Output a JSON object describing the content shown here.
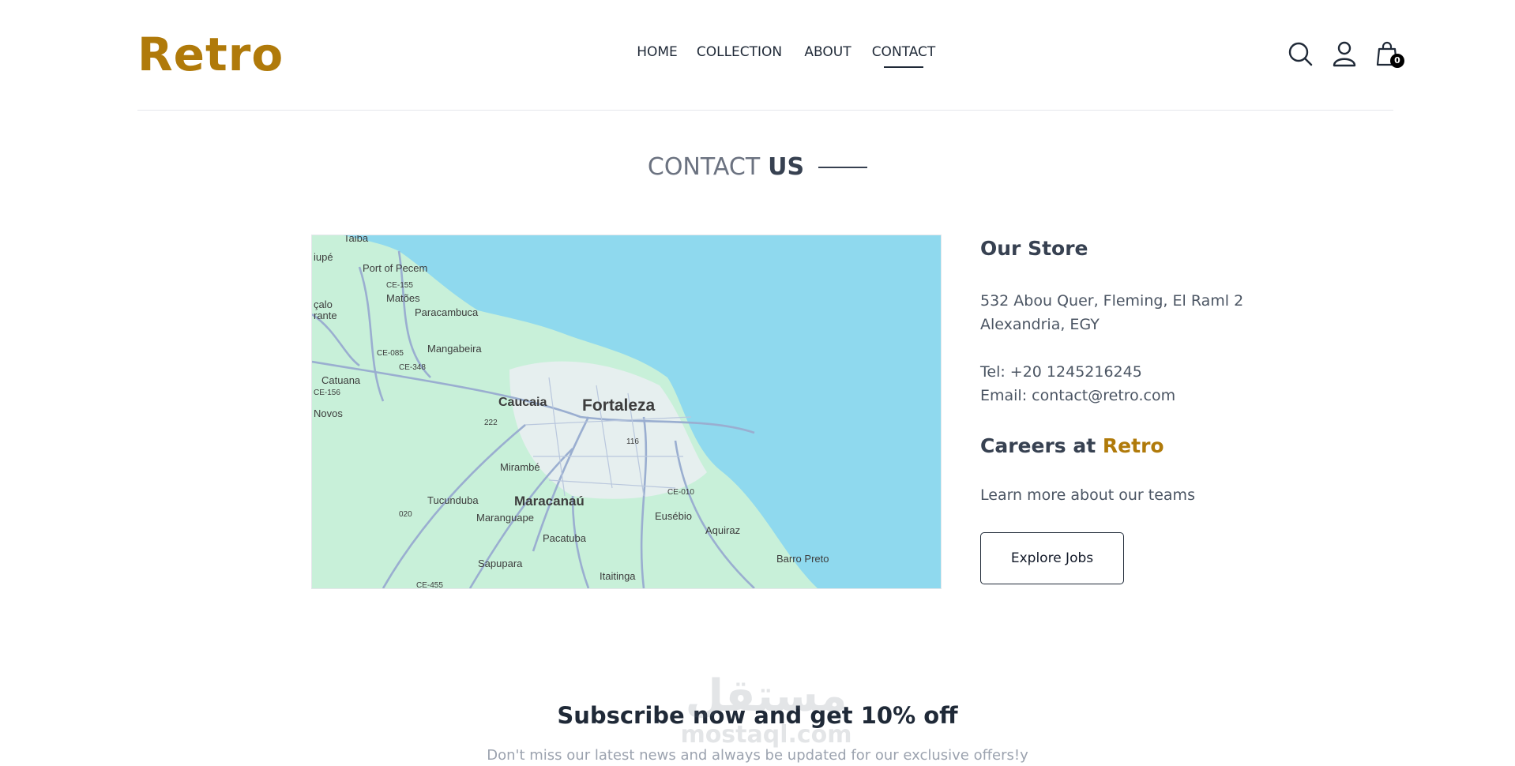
{
  "header": {
    "logo": "Retro",
    "nav": [
      {
        "label": "HOME"
      },
      {
        "label": "COLLECTION"
      },
      {
        "label": "ABOUT"
      },
      {
        "label": "CONTACT"
      }
    ],
    "cart_count": "0",
    "icons": [
      "search-icon",
      "user-icon",
      "shopping-bag-icon"
    ]
  },
  "title": {
    "light": "CONTACT",
    "strong": "US"
  },
  "map": {
    "labels": [
      "Taiba",
      "iupé",
      "Port of Pecem",
      "CE-155",
      "Matões",
      "Paracambuca",
      "çalo",
      "rante",
      "CE-085",
      "Mangabeira",
      "CE-348",
      "Catuana",
      "CE-156",
      "Novos",
      "Caucaia",
      "Fortaleza",
      "222",
      "116",
      "Mirambé",
      "CE-010",
      "Tucunduba",
      "Maracanaú",
      "020",
      "Maranguape",
      "Eusébio",
      "Aquiraz",
      "Pacatuba",
      "Sapupara",
      "Barro Preto",
      "Itaitinga",
      "CE-455"
    ],
    "colors": {
      "sea": "#8fd9ee",
      "land": "#c8f0d9",
      "roads": "#9aaed0",
      "urban": "#ebeef2"
    }
  },
  "store": {
    "heading": "Our Store",
    "address_line1": "532 Abou Quer, Fleming, El Raml 2",
    "address_line2": "Alexandria, EGY",
    "tel": "Tel: +20 1245216245",
    "email": "Email: contact@retro.com"
  },
  "careers": {
    "heading_prefix": "Careers at",
    "heading_brand": "Retro",
    "text": "Learn more about our teams",
    "button": "Explore Jobs"
  },
  "subscribe": {
    "title": "Subscribe now and get 10% off",
    "text": "Don't miss our latest news and always be updated for our exclusive offers!y"
  },
  "watermark": {
    "arabic": "مستقل",
    "latin": "mostaql.com"
  },
  "colors": {
    "brand": "#b07a0a",
    "text": "#374151"
  }
}
